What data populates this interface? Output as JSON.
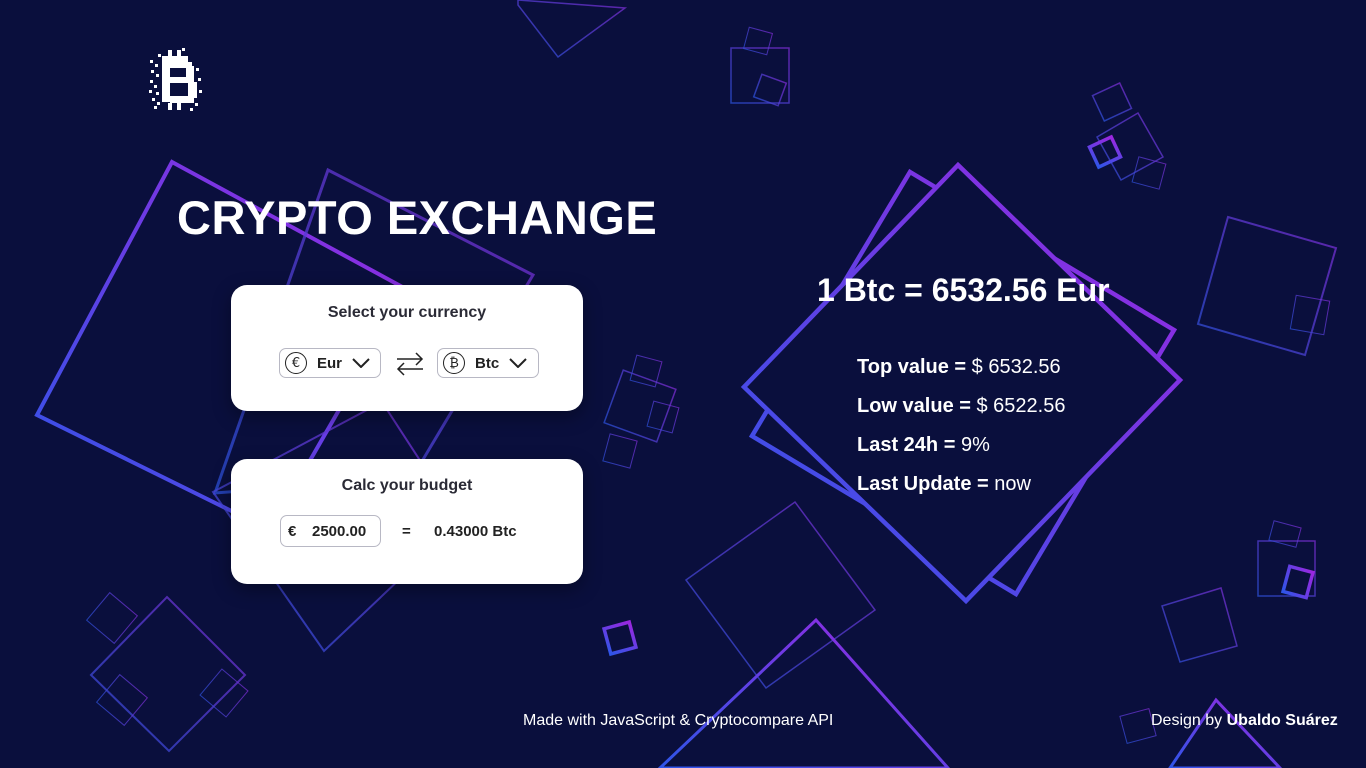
{
  "app": {
    "title": "CRYPTO EXCHANGE"
  },
  "colors": {
    "background": "#0a0f3d",
    "accent_blue": "#2f55e8",
    "accent_purple": "#9b27e0",
    "card": "#ffffff"
  },
  "logo": {
    "icon": "bitcoin-pixel-logo"
  },
  "currency_card": {
    "title": "Select your currency",
    "from": {
      "symbol": "€",
      "code": "Eur",
      "icon": "euro-coin-icon"
    },
    "to": {
      "symbol": "₿",
      "code": "Btc",
      "icon": "bitcoin-coin-icon"
    },
    "swap_icon": "swap-arrows-icon"
  },
  "budget_card": {
    "title": "Calc your budget",
    "currency_symbol": "€",
    "amount": "2500.00",
    "equals": "=",
    "result": "0.43000 Btc"
  },
  "rate": {
    "text": "1 Btc = 6532.56 Eur"
  },
  "stats": [
    {
      "label": "Top value =",
      "value": "$ 6532.56"
    },
    {
      "label": "Low value =",
      "value": "$ 6522.56"
    },
    {
      "label": "Last 24h =",
      "value": "9%"
    },
    {
      "label": "Last Update =",
      "value": "now"
    }
  ],
  "footer": {
    "made_with": "Made with JavaScript & Cryptocompare API",
    "design_prefix": "Design by",
    "design_author": "Ubaldo Suárez"
  }
}
